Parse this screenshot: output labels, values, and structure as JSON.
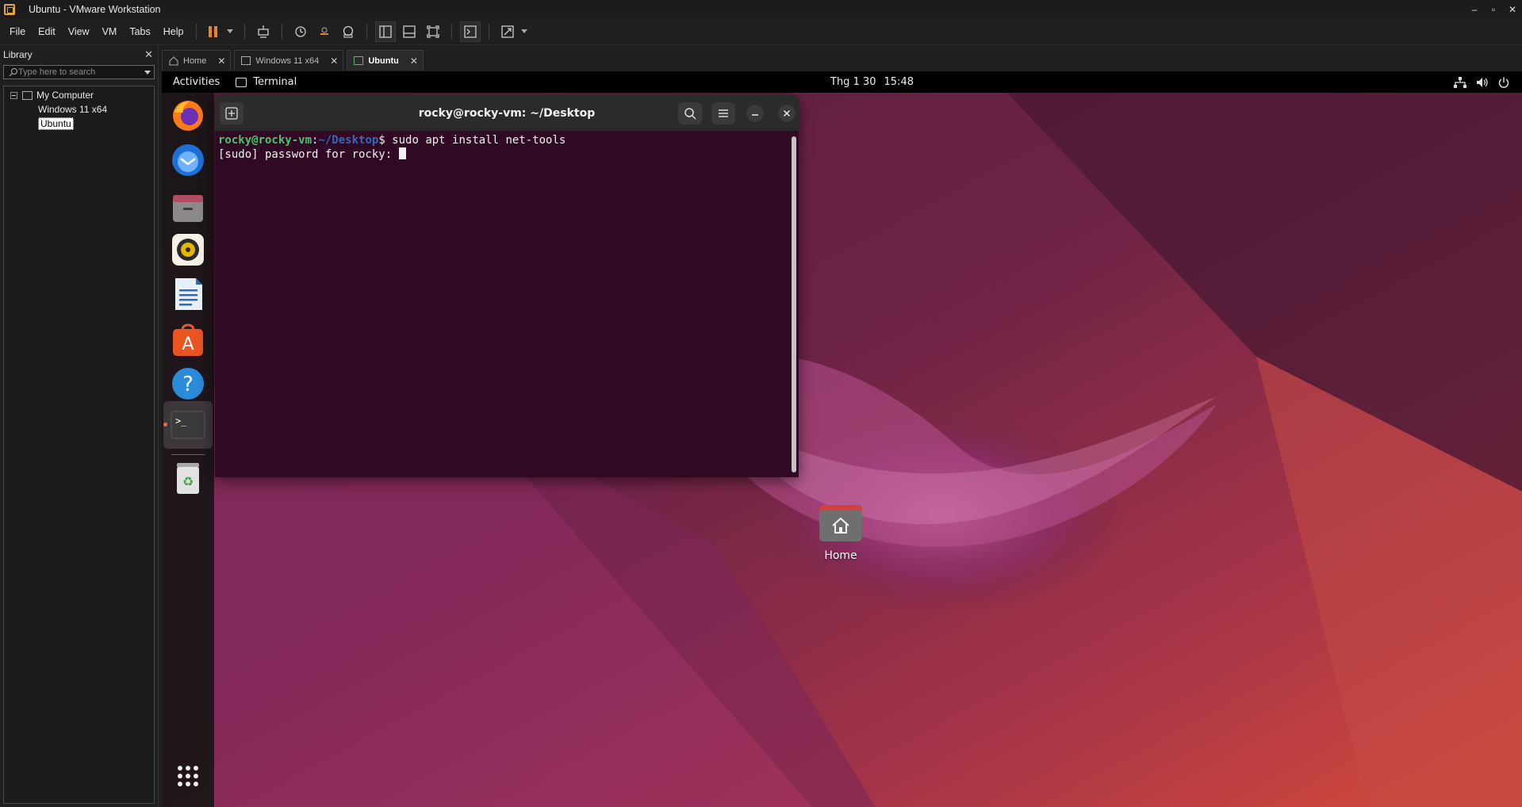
{
  "window": {
    "title": "Ubuntu - VMware Workstation",
    "controls": [
      "–",
      "▫",
      "✕"
    ]
  },
  "menu": [
    "File",
    "Edit",
    "View",
    "VM",
    "Tabs",
    "Help"
  ],
  "toolbar": {
    "accent": "#e9822d"
  },
  "library": {
    "title": "Library",
    "search_placeholder": "Type here to search",
    "tree": {
      "root": "My Computer",
      "vms": [
        "Windows 11 x64",
        "Ubuntu"
      ]
    }
  },
  "tabs": [
    {
      "label": "Home",
      "active": false
    },
    {
      "label": "Windows 11 x64",
      "active": false
    },
    {
      "label": "Ubuntu",
      "active": true
    }
  ],
  "ubuntu": {
    "topbar": {
      "activities": "Activities",
      "app": "Terminal",
      "date": "Thg 1 30",
      "time": "15:48"
    },
    "terminal": {
      "title": "rocky@rocky-vm: ~/Desktop",
      "prompt_user": "rocky@rocky-vm",
      "prompt_sep": ":",
      "prompt_path": "~/Desktop",
      "prompt_end": "$ ",
      "command": "sudo apt install net-tools",
      "line2": "[sudo] password for rocky: "
    },
    "desktop": {
      "home_label": "Home"
    },
    "colors": {
      "accent": "#e95420",
      "terminal_bg": "#300a24",
      "prompt_user": "#4ec26a",
      "prompt_path": "#3a67b8"
    }
  }
}
